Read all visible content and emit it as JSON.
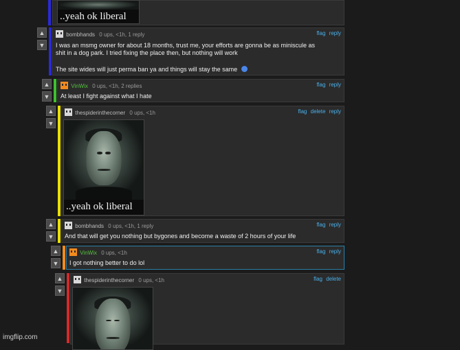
{
  "colors": {
    "blue_bar": "#2a2ad8",
    "green_bar": "#3fbf2e",
    "yellow_bar": "#e8e000",
    "orange_bar": "#f28a1e",
    "red_bar": "#d42a2a",
    "link": "#4ab0ea",
    "username_green": "#55c23f"
  },
  "top_meme": {
    "caption": "..yeah ok liberal"
  },
  "comments": [
    {
      "username": "bombhands",
      "avatar_icon": "white-pixel-avatar-icon",
      "stats": "0 ups, <1h, 1 reply",
      "actions": [
        "flag",
        "reply"
      ],
      "text_lines": [
        "I was an msmg owner for about 18 months, trust me, your efforts are gonna be as miniscule as",
        "shit in a dog park. I tried fixing the place then, but nothing will work",
        "",
        "The site wides will just perma ban ya and things will stay the same"
      ],
      "emoji_icon": "bug-emoji-icon"
    },
    {
      "username": "VinWix",
      "avatar_icon": "orange-pixel-avatar-icon",
      "stats": "0 ups, <1h, 2 replies",
      "actions": [
        "flag",
        "reply"
      ],
      "text": "At least I fight against what I hate"
    },
    {
      "username": "thespiderinthecorner",
      "avatar_icon": "white-pixel-avatar-icon",
      "stats": "0 ups, <1h",
      "actions": [
        "flag",
        "delete",
        "reply"
      ],
      "meme_caption": "..yeah ok liberal"
    },
    {
      "username": "bombhands",
      "avatar_icon": "white-pixel-avatar-icon",
      "stats": "0 ups, <1h, 1 reply",
      "actions": [
        "flag",
        "reply"
      ],
      "text": "And that will get you nothing but bygones and become a waste of 2 hours of your life"
    },
    {
      "username": "VinWix",
      "avatar_icon": "orange-pixel-avatar-icon",
      "stats": "0 ups, <1h",
      "actions": [
        "flag",
        "reply"
      ],
      "text": "I got nothing better to do lol"
    },
    {
      "username": "thespiderinthecorner",
      "avatar_icon": "white-pixel-avatar-icon",
      "stats": "0 ups, <1h",
      "actions": [
        "flag",
        "delete"
      ]
    }
  ],
  "vote_icons": {
    "up": "▲",
    "down": "▼"
  },
  "watermark": "imgflip.com"
}
